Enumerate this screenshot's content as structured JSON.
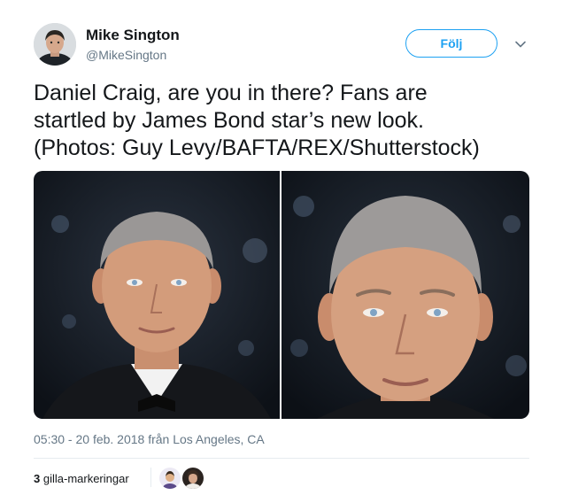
{
  "author": {
    "name": "Mike Sington",
    "handle": "@MikeSington"
  },
  "follow_label": "Följ",
  "tweet": {
    "lines": [
      "Daniel Craig, are you in there? Fans are",
      "startled by James Bond star’s new look.",
      "(Photos: Guy Levy/BAFTA/REX/Shutterstock)"
    ]
  },
  "media": {
    "photos": [
      {
        "description_icon": "photo-before"
      },
      {
        "description_icon": "photo-after"
      }
    ]
  },
  "timestamp": "05:30 - 20 feb. 2018 från Los Angeles, CA",
  "stats": {
    "likes_count": "3",
    "likes_label": "gilla-markeringar"
  },
  "colors": {
    "accent": "#1da1f2",
    "secondary_text": "#657786",
    "primary_text": "#14171a",
    "divider": "#e6ecf0"
  }
}
